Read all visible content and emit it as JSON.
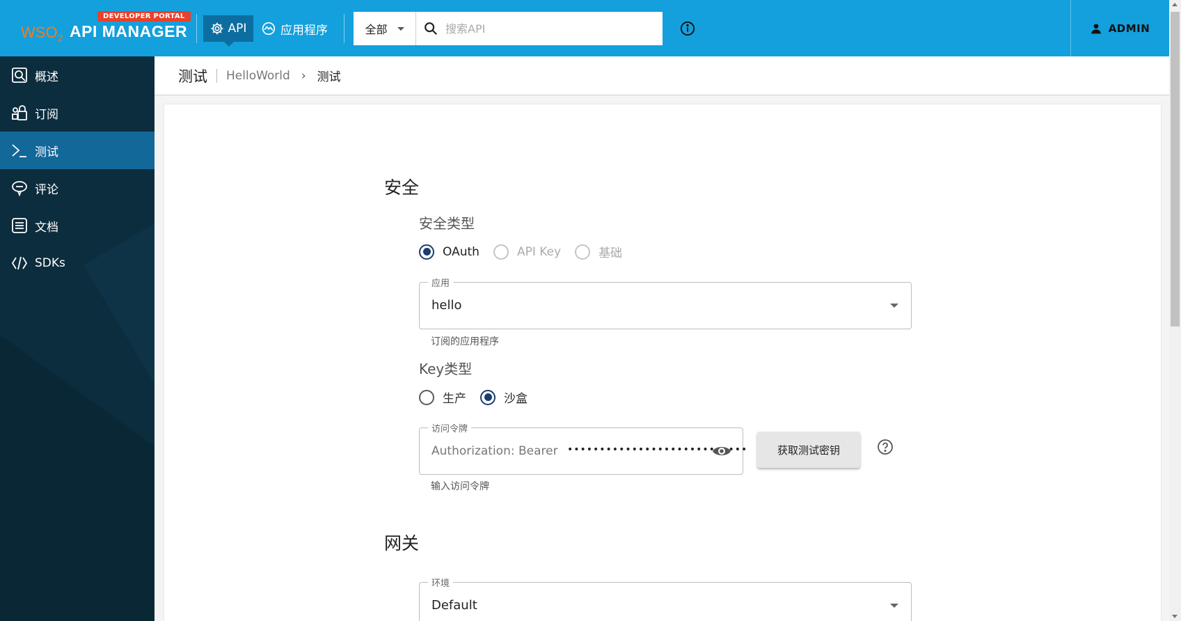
{
  "header": {
    "badge": "DEVELOPER PORTAL",
    "brand_wso": "WSO",
    "brand_sub": "2",
    "brand_name": "API MANAGER",
    "nav_api": "API",
    "nav_apps": "应用程序",
    "search_scope": "全部",
    "search_placeholder": "搜索API",
    "user": "ADMIN"
  },
  "sidebar": {
    "items": [
      {
        "label": "概述",
        "icon": "overview-icon"
      },
      {
        "label": "订阅",
        "icon": "subscriptions-icon"
      },
      {
        "label": "测试",
        "icon": "terminal-icon"
      },
      {
        "label": "评论",
        "icon": "comment-icon"
      },
      {
        "label": "文档",
        "icon": "document-icon"
      },
      {
        "label": "SDKs",
        "icon": "code-icon"
      }
    ],
    "active_index": 2
  },
  "breadcrumb": {
    "title": "测试",
    "api": "HelloWorld",
    "current": "测试"
  },
  "security": {
    "title": "安全",
    "type_label": "安全类型",
    "types": [
      "OAuth",
      "API Key",
      "基础"
    ],
    "selected_type": "OAuth",
    "application": {
      "legend": "应用",
      "value": "hello",
      "helper": "订阅的应用程序"
    },
    "key_type_label": "Key类型",
    "key_types": [
      "生产",
      "沙盒"
    ],
    "selected_key_type": "沙盒",
    "token": {
      "legend": "访问令牌",
      "prefix": "Authorization: Bearer",
      "masked": "••••••••••••••••••••••••••••",
      "helper": "输入访问令牌",
      "button": "获取测试密钥"
    }
  },
  "gateway": {
    "title": "网关",
    "environment": {
      "legend": "环境",
      "value": "Default"
    }
  },
  "colors": {
    "header": "#13a0dc",
    "sidebar": "#0c2d3e",
    "sidebar_active": "#13689a",
    "radio_selected": "#1a3c6e",
    "badge": "#e8412c"
  }
}
